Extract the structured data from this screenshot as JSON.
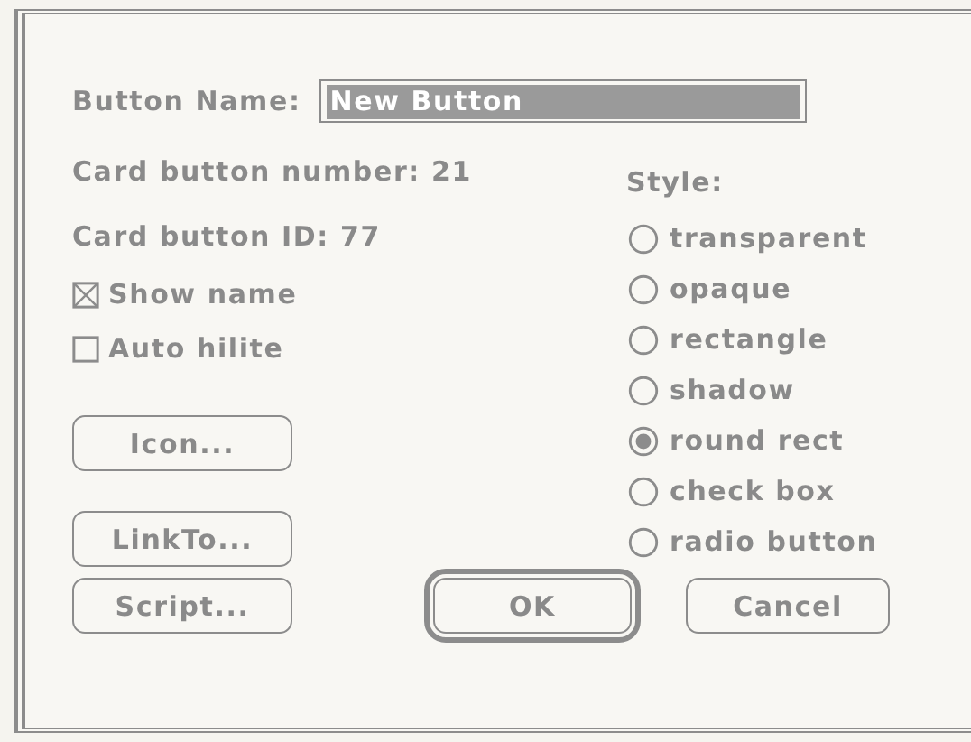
{
  "name_field": {
    "label": "Button Name:",
    "value": "New Button",
    "highlighted": true
  },
  "info": [
    "Card button number: 21",
    "Card button ID: 77"
  ],
  "options": [
    {
      "label": "Show name",
      "checked": true
    },
    {
      "label": "Auto hilite",
      "checked": false
    }
  ],
  "side_buttons": [
    "Icon...",
    "LinkTo..."
  ],
  "style": {
    "label": "Style:",
    "choices": [
      {
        "label": "transparent",
        "selected": false
      },
      {
        "label": "opaque",
        "selected": false
      },
      {
        "label": "rectangle",
        "selected": false
      },
      {
        "label": "shadow",
        "selected": false
      },
      {
        "label": "round rect",
        "selected": true
      },
      {
        "label": "check box",
        "selected": false
      },
      {
        "label": "radio button",
        "selected": false
      }
    ]
  },
  "bottom_buttons": [
    {
      "label": "Script...",
      "default": false
    },
    {
      "label": "OK",
      "default": true
    },
    {
      "label": "Cancel",
      "default": false
    }
  ]
}
